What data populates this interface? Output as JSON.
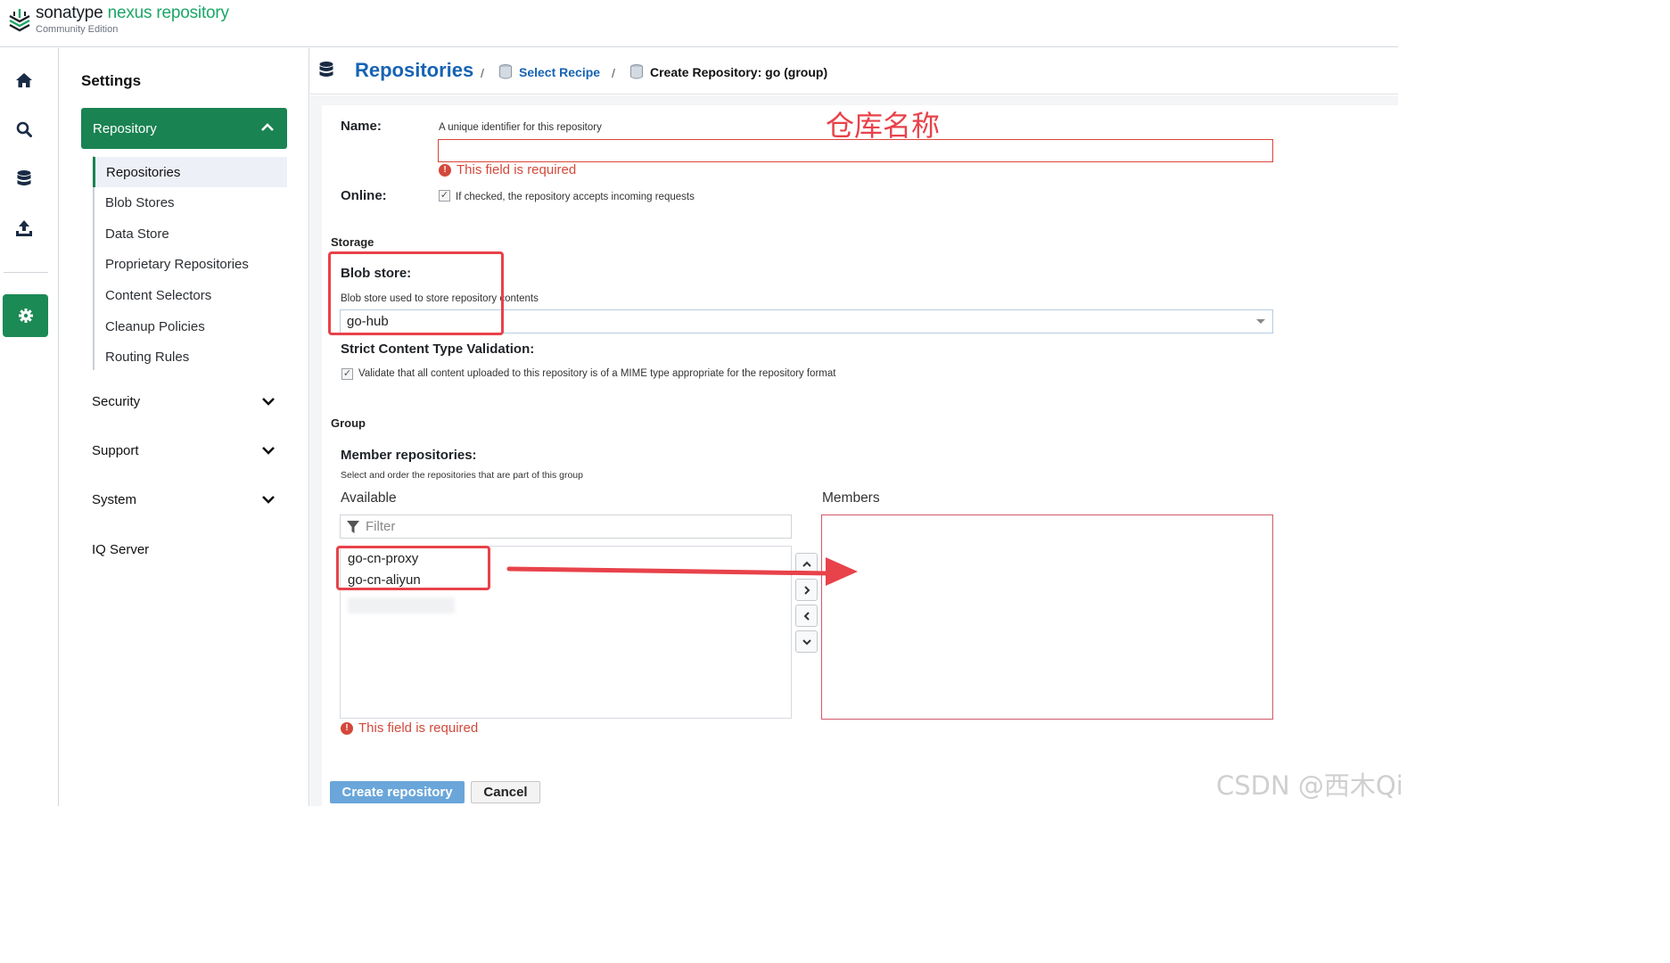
{
  "brand": {
    "name_part1": "sonatype",
    "name_part2": "nexus repository",
    "edition": "Community Edition"
  },
  "rail": {
    "icons": [
      "home-icon",
      "search-icon",
      "database-icon",
      "upload-icon",
      "gear-icon"
    ]
  },
  "sidebar": {
    "title": "Settings",
    "repository": {
      "label": "Repository",
      "items": [
        "Repositories",
        "Blob Stores",
        "Data Store",
        "Proprietary Repositories",
        "Content Selectors",
        "Cleanup Policies",
        "Routing Rules"
      ]
    },
    "sections": [
      "Security",
      "Support",
      "System",
      "IQ Server"
    ]
  },
  "breadcrumb": {
    "title": "Repositories",
    "sep": "/",
    "recipe": "Select Recipe",
    "create": "Create Repository: go (group)"
  },
  "form": {
    "name_label": "Name:",
    "name_help": "A unique identifier for this repository",
    "name_error": "This field is required",
    "online_label": "Online:",
    "online_help": "If checked, the repository accepts incoming requests",
    "storage_section": "Storage",
    "blob_label": "Blob store:",
    "blob_help": "Blob store used to store repository contents",
    "blob_value": "go-hub",
    "strict_label": "Strict Content Type Validation:",
    "strict_help": "Validate that all content uploaded to this repository is of a MIME type appropriate for the repository format",
    "group_section": "Group",
    "members_label": "Member repositories:",
    "members_help": "Select and order the repositories that are part of this group",
    "available_label": "Available",
    "members_col_label": "Members",
    "filter_placeholder": "Filter",
    "available_items": [
      "go-cn-proxy",
      "go-cn-aliyun"
    ],
    "members_error": "This field is required",
    "create_button": "Create repository",
    "cancel_button": "Cancel"
  },
  "annotation": {
    "name_note": "仓库名称"
  },
  "watermark": "CSDN @西木Qi",
  "colors": {
    "brand_green": "#1aa765",
    "nav_green": "#1a8352",
    "link_blue": "#1763b3",
    "error_red": "#d4483b",
    "annotation_red": "#e8424a",
    "button_blue": "#6aa6da"
  }
}
